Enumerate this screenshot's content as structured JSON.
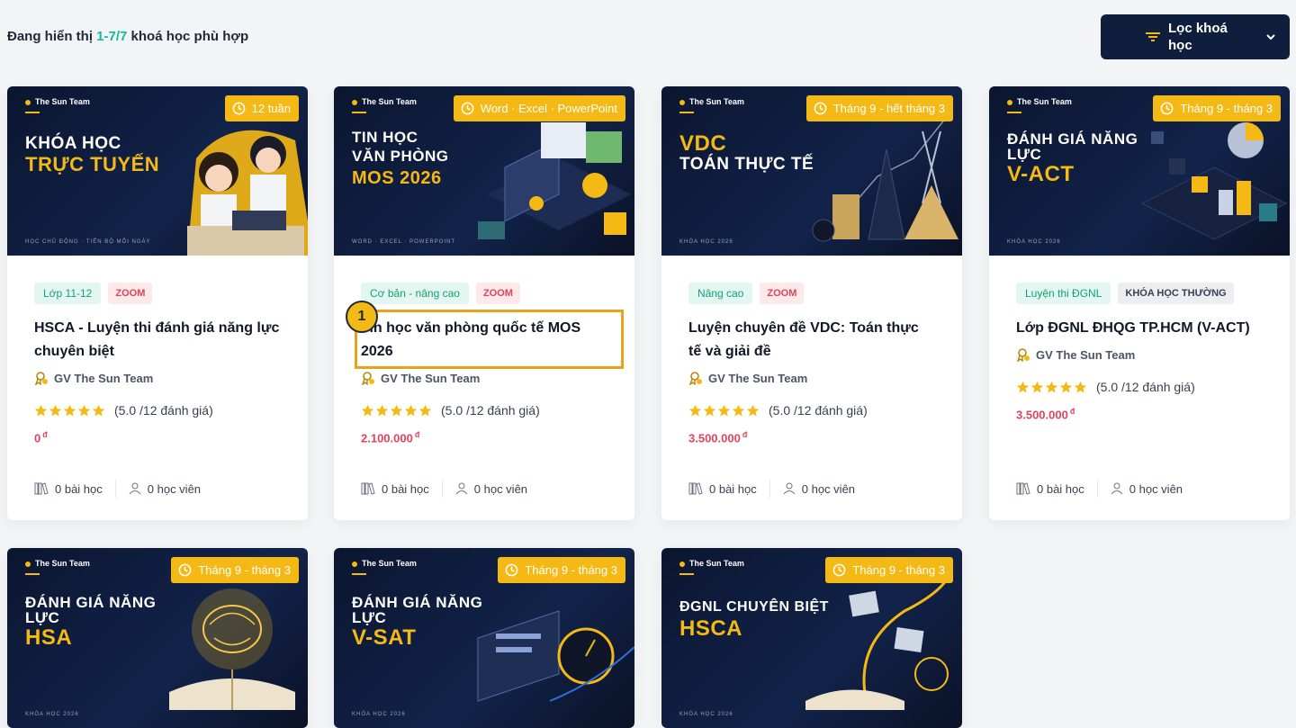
{
  "header": {
    "summary_prefix": "Đang hiển thị",
    "summary_range": "1-7/7",
    "summary_suffix": "khoá học phù hợp",
    "filter_label": "Lọc khoá học",
    "filter_icon": "filter-lines-icon",
    "chevron_icon": "chevron-down-icon"
  },
  "colors": {
    "accent": "#f5b915",
    "teal": "#14b8a6",
    "price": "#e0435b",
    "navy": "#0f1e3c"
  },
  "annotation": {
    "marker_label": "1"
  },
  "courses": [
    {
      "brand": "The Sun Team",
      "image_title_line1": "KHÓA HỌC",
      "image_title_line2": "TRỰC TUYẾN",
      "image_footer": "HỌC CHỦ ĐỘNG · TIẾN BỘ MỖI NGÀY",
      "badge": "12 tuần",
      "tags": [
        "Lớp 11-12",
        "ZOOM"
      ],
      "title": "HSCA - Luyện thi đánh giá năng lực chuyên biệt",
      "teacher": "GV The Sun Team",
      "rating_text": "(5.0 /12 đánh giá)",
      "rating": 5,
      "price": "0",
      "currency": "đ",
      "lessons": "0 bài học",
      "students": "0 học viên"
    },
    {
      "brand": "The Sun Team",
      "image_title_line1": "TIN HỌC",
      "image_title_line2": "VĂN PHÒNG",
      "image_title_line3": "MOS 2026",
      "image_footer": "WORD · EXCEL · POWERPOINT",
      "badge": "Word · Excel · PowerPoint",
      "tags": [
        "Cơ bản - nâng cao",
        "ZOOM"
      ],
      "title": "Tin học văn phòng quốc tế MOS 2026",
      "teacher": "GV The Sun Team",
      "rating_text": "(5.0 /12 đánh giá)",
      "rating": 5,
      "price": "2.100.000",
      "currency": "đ",
      "lessons": "0 bài học",
      "students": "0 học viên"
    },
    {
      "brand": "The Sun Team",
      "image_title_line1": "VDC",
      "image_title_line2": "TOÁN THỰC TẾ",
      "image_footer": "KHÓA HỌC 2026",
      "badge": "Tháng 9 - hết tháng 3",
      "tags": [
        "Nâng cao",
        "ZOOM"
      ],
      "title": "Luyện chuyên đề VDC: Toán thực tế và giải đề",
      "teacher": "GV The Sun Team",
      "rating_text": "(5.0 /12 đánh giá)",
      "rating": 5,
      "price": "3.500.000",
      "currency": "đ",
      "lessons": "0 bài học",
      "students": "0 học viên"
    },
    {
      "brand": "The Sun Team",
      "image_title_line1": "ĐÁNH GIÁ NĂNG",
      "image_title_line2": "LỰC",
      "image_title_line3": "V-ACT",
      "image_footer": "KHÓA HỌC 2026",
      "badge": "Tháng 9 - tháng 3",
      "tags": [
        "Luyện thi ĐGNL",
        "KHÓA HỌC THƯỜNG"
      ],
      "title": "Lớp ĐGNL ĐHQG TP.HCM (V-ACT)",
      "teacher": "GV The Sun Team",
      "rating_text": "(5.0 /12 đánh giá)",
      "rating": 5,
      "price": "3.500.000",
      "currency": "đ",
      "lessons": "0 bài học",
      "students": "0 học viên"
    },
    {
      "brand": "The Sun Team",
      "image_title_line1": "ĐÁNH GIÁ NĂNG",
      "image_title_line2": "LỰC",
      "image_title_line3": "HSA",
      "image_footer": "KHÓA HỌC 2026",
      "badge": "Tháng 9 - tháng 3"
    },
    {
      "brand": "The Sun Team",
      "image_title_line1": "ĐÁNH GIÁ NĂNG",
      "image_title_line2": "LỰC",
      "image_title_line3": "V-SAT",
      "image_footer": "KHÓA HỌC 2026",
      "badge": "Tháng 9 - tháng 3"
    },
    {
      "brand": "The Sun Team",
      "image_title_line1": "ĐGNL CHUYÊN BIỆT",
      "image_title_line2": "HSCA",
      "image_footer": "KHÓA HỌC 2026",
      "badge": "Tháng 9 - tháng 3"
    }
  ]
}
